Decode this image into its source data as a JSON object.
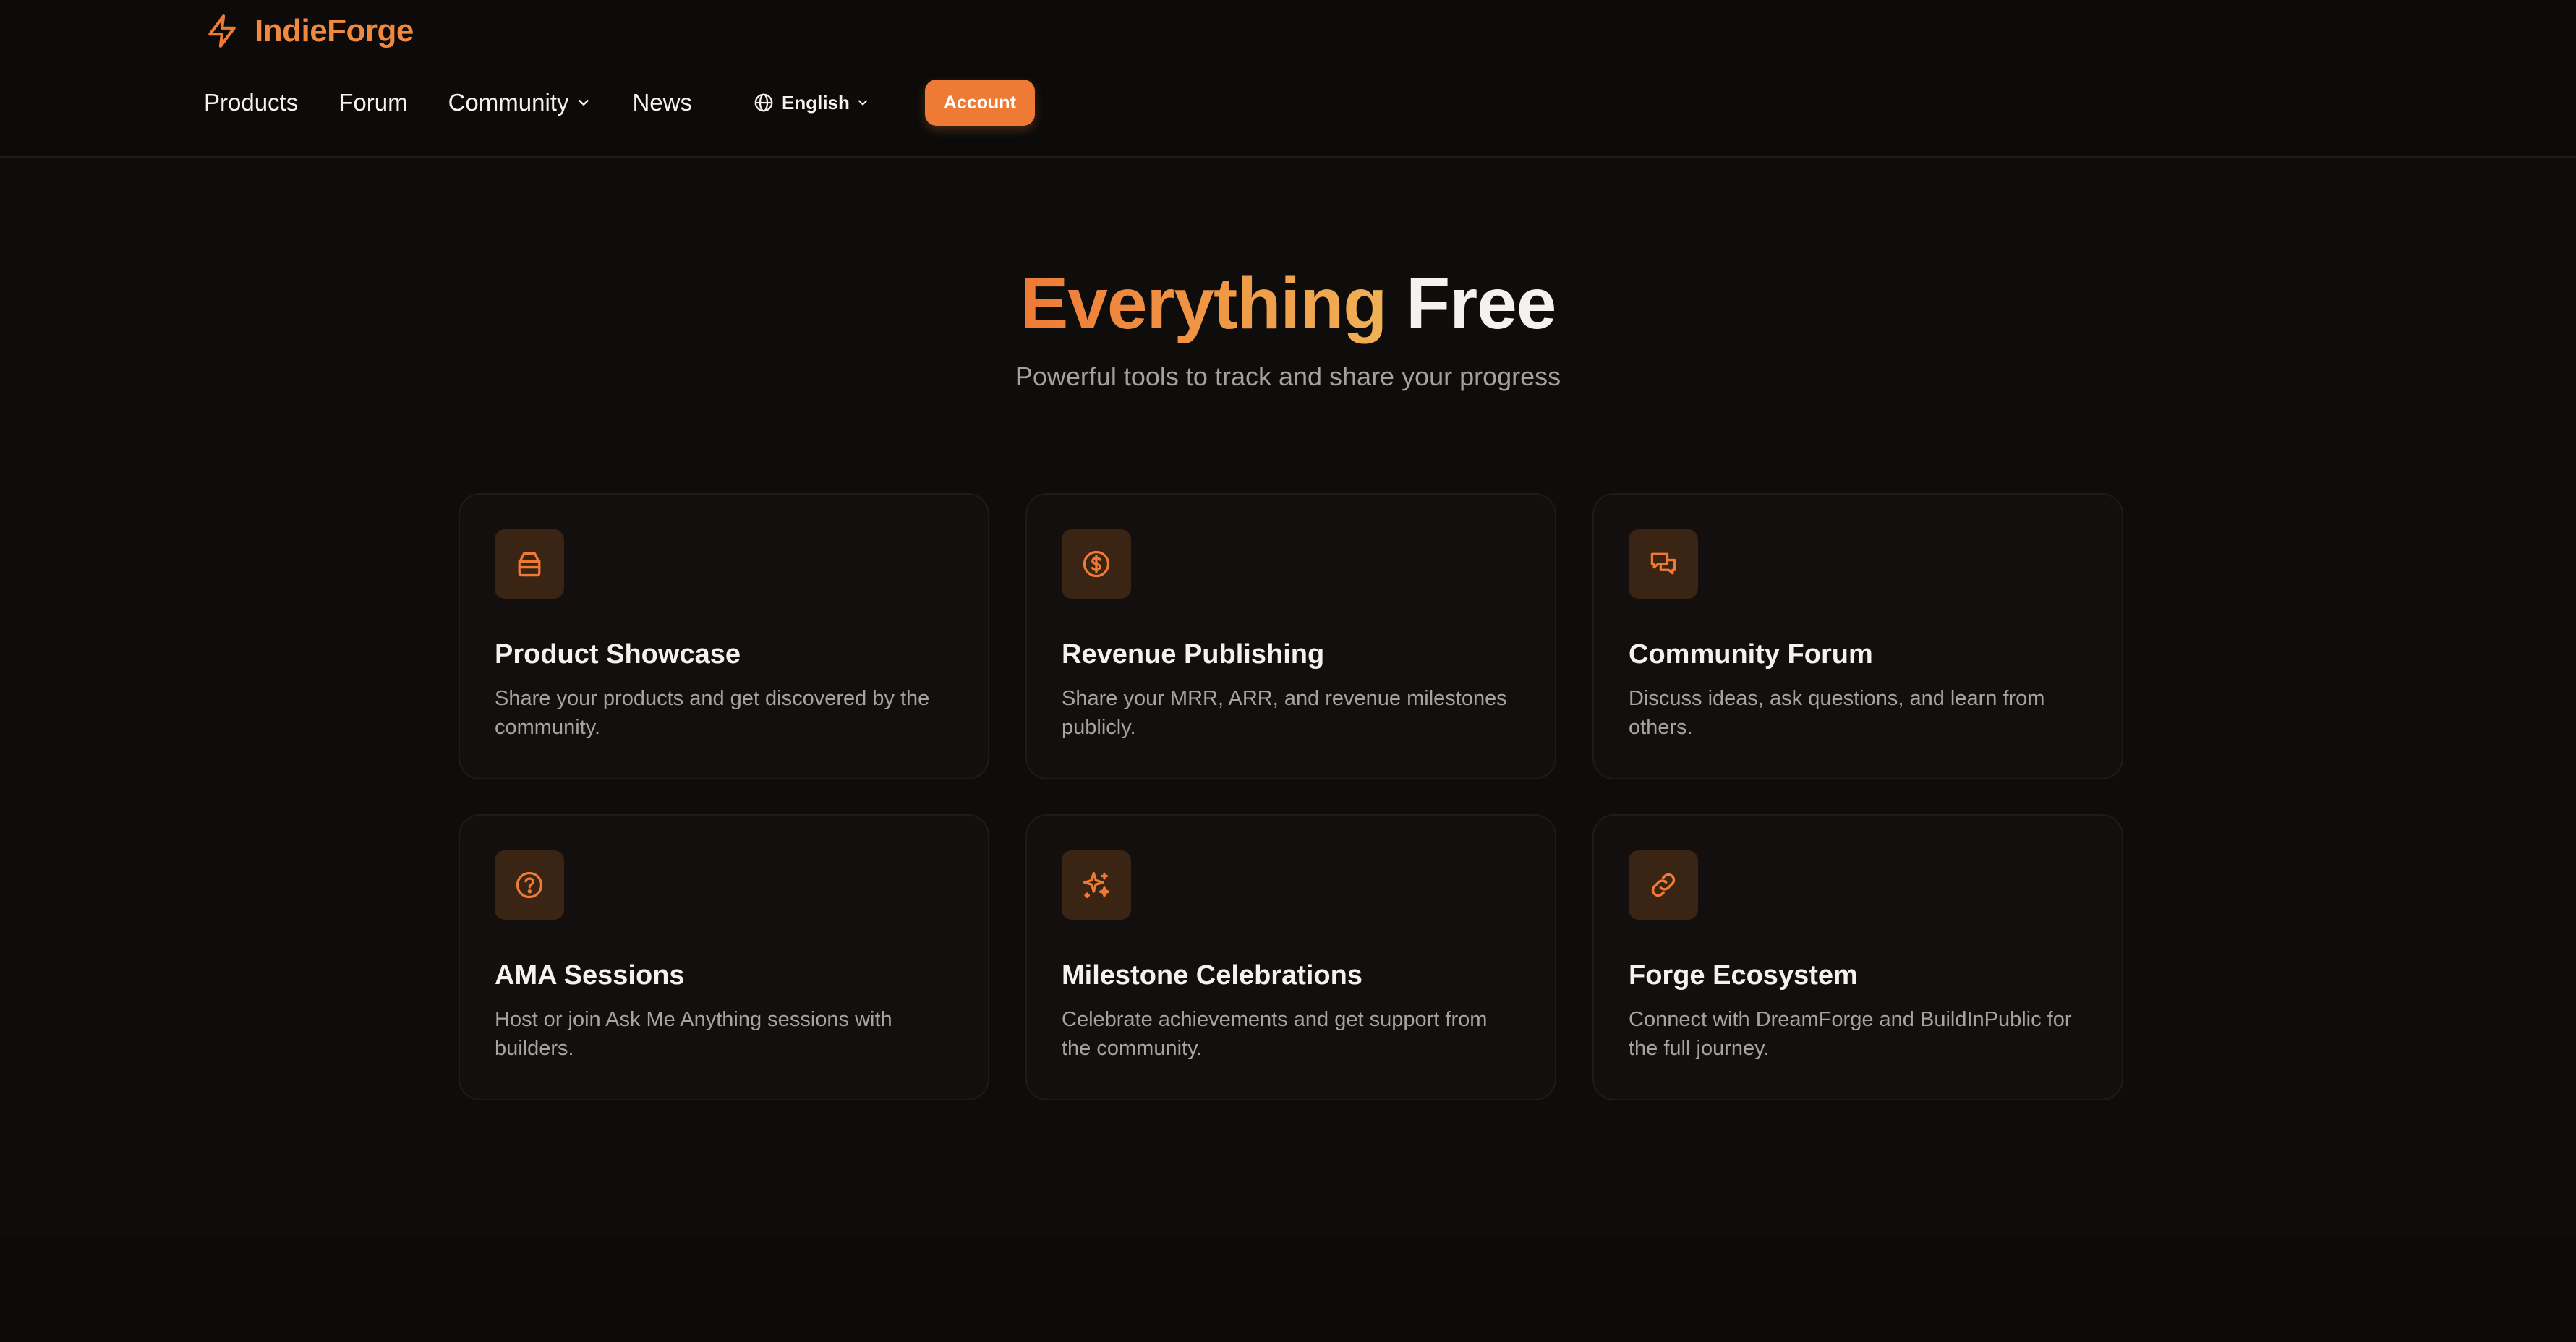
{
  "brand": {
    "name": "IndieForge",
    "icon": "lightning-bolt-icon",
    "accent_color": "#ee7a35"
  },
  "nav": {
    "items": [
      {
        "label": "Products"
      },
      {
        "label": "Forum"
      },
      {
        "label": "Community",
        "has_dropdown": true
      },
      {
        "label": "News"
      }
    ],
    "language": {
      "label": "English",
      "icon": "globe-icon"
    },
    "account_label": "Account"
  },
  "hero": {
    "title_accent": "Everything",
    "title_plain": "Free",
    "subtitle": "Powerful tools to track and share your progress"
  },
  "features": [
    {
      "icon": "store-icon",
      "title": "Product Showcase",
      "description": "Share your products and get discovered by the community."
    },
    {
      "icon": "dollar-circle-icon",
      "title": "Revenue Publishing",
      "description": "Share your MRR, ARR, and revenue milestones publicly."
    },
    {
      "icon": "chat-bubbles-icon",
      "title": "Community Forum",
      "description": "Discuss ideas, ask questions, and learn from others."
    },
    {
      "icon": "question-circle-icon",
      "title": "AMA Sessions",
      "description": "Host or join Ask Me Anything sessions with builders."
    },
    {
      "icon": "sparkles-icon",
      "title": "Milestone Celebrations",
      "description": "Celebrate achievements and get support from the community."
    },
    {
      "icon": "link-icon",
      "title": "Forge Ecosystem",
      "description": "Connect with DreamForge and BuildInPublic for the full journey."
    }
  ],
  "colors": {
    "background": "#0f0d0c",
    "card_background": "#120f0e",
    "icon_tile": "#3a2414",
    "icon_stroke": "#ee7a35"
  }
}
